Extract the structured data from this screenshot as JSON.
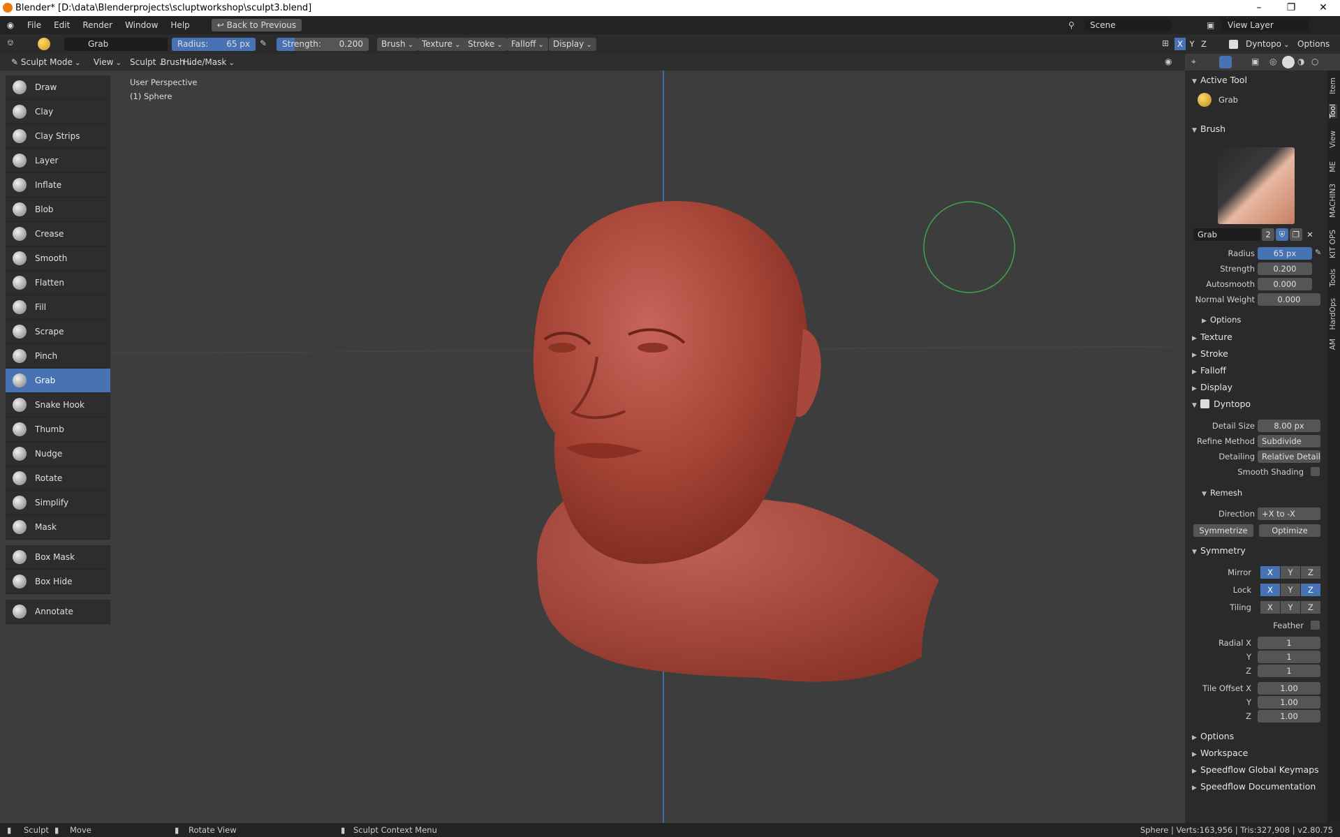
{
  "window": {
    "title": "Blender* [D:\\data\\Blenderprojects\\scluptworkshop\\sculpt3.blend]",
    "minimize": "–",
    "maximize": "❐",
    "close": "✕"
  },
  "menubar": {
    "items": [
      "File",
      "Edit",
      "Render",
      "Window",
      "Help"
    ],
    "back_button": "Back to Previous",
    "scene": "Scene",
    "view_layer": "View Layer"
  },
  "toolheader": {
    "brush_name": "Grab",
    "radius_label": "Radius:",
    "radius_value": "65 px",
    "strength_label": "Strength:",
    "strength_value": "0.200",
    "strength_fraction": 0.2,
    "menus": [
      "Brush",
      "Texture",
      "Stroke",
      "Falloff",
      "Display"
    ],
    "axes": [
      "X",
      "Y",
      "Z"
    ],
    "dyntopo": "Dyntopo",
    "options": "Options"
  },
  "modeheader": {
    "mode": "Sculpt Mode",
    "menus": [
      "View",
      "Sculpt",
      "Brush",
      "Hide/Mask"
    ]
  },
  "viewport": {
    "perspective": "User Perspective",
    "object": "(1) Sphere"
  },
  "tools": [
    "Draw",
    "Clay",
    "Clay Strips",
    "Layer",
    "Inflate",
    "Blob",
    "Crease",
    "Smooth",
    "Flatten",
    "Fill",
    "Scrape",
    "Pinch",
    "Grab",
    "Snake Hook",
    "Thumb",
    "Nudge",
    "Rotate",
    "Simplify",
    "Mask"
  ],
  "active_tool": "Grab",
  "tools2": [
    "Box Mask",
    "Box Hide"
  ],
  "tools3": [
    "Annotate"
  ],
  "panel": {
    "active_tool_title": "Active Tool",
    "active_tool_name": "Grab",
    "brush_title": "Brush",
    "brush_name": "Grab",
    "brush_users": "2",
    "radius_label": "Radius",
    "radius": "65 px",
    "strength_label": "Strength",
    "strength": "0.200",
    "autosmooth_label": "Autosmooth",
    "autosmooth": "0.000",
    "normal_weight_label": "Normal Weight",
    "normal_weight": "0.000",
    "options_sub": "Options",
    "texture": "Texture",
    "stroke": "Stroke",
    "falloff": "Falloff",
    "display": "Display",
    "dyntopo": "Dyntopo",
    "detail_size_label": "Detail Size",
    "detail_size": "8.00 px",
    "refine_label": "Refine Method",
    "refine": "Subdivide Ed...",
    "detailing_label": "Detailing",
    "detailing": "Relative Detail",
    "smooth_shading": "Smooth Shading",
    "remesh": "Remesh",
    "direction_label": "Direction",
    "direction": "+X to -X",
    "symmetrize": "Symmetrize",
    "optimize": "Optimize",
    "symmetry": "Symmetry",
    "mirror": "Mirror",
    "lock": "Lock",
    "tiling": "Tiling",
    "feather": "Feather",
    "radial_x_label": "Radial X",
    "y_label": "Y",
    "z_label": "Z",
    "radial_x": "1",
    "radial_y": "1",
    "radial_z": "1",
    "tile_offset_label": "Tile Offset X",
    "tile_x": "1.00",
    "tile_y": "1.00",
    "tile_z": "1.00",
    "options": "Options",
    "workspace": "Workspace",
    "speedflow_keymaps": "Speedflow Global Keymaps",
    "speedflow_docs": "Speedflow Documentation"
  },
  "vtabs": [
    "Item",
    "Tool",
    "View",
    "ME",
    "MACHIN3",
    "KIT OPS",
    "Tools",
    "HardOps",
    "AM"
  ],
  "status": {
    "sculpt": "Sculpt",
    "move": "Move",
    "rotate": "Rotate View",
    "context": "Sculpt Context Menu",
    "stats": "Sphere | Verts:163,956 | Tris:327,908 | v2.80.75"
  },
  "colors": {
    "accent": "#4772b3",
    "skin": "#b04a3e",
    "brush_circle": "#3fa34d"
  }
}
